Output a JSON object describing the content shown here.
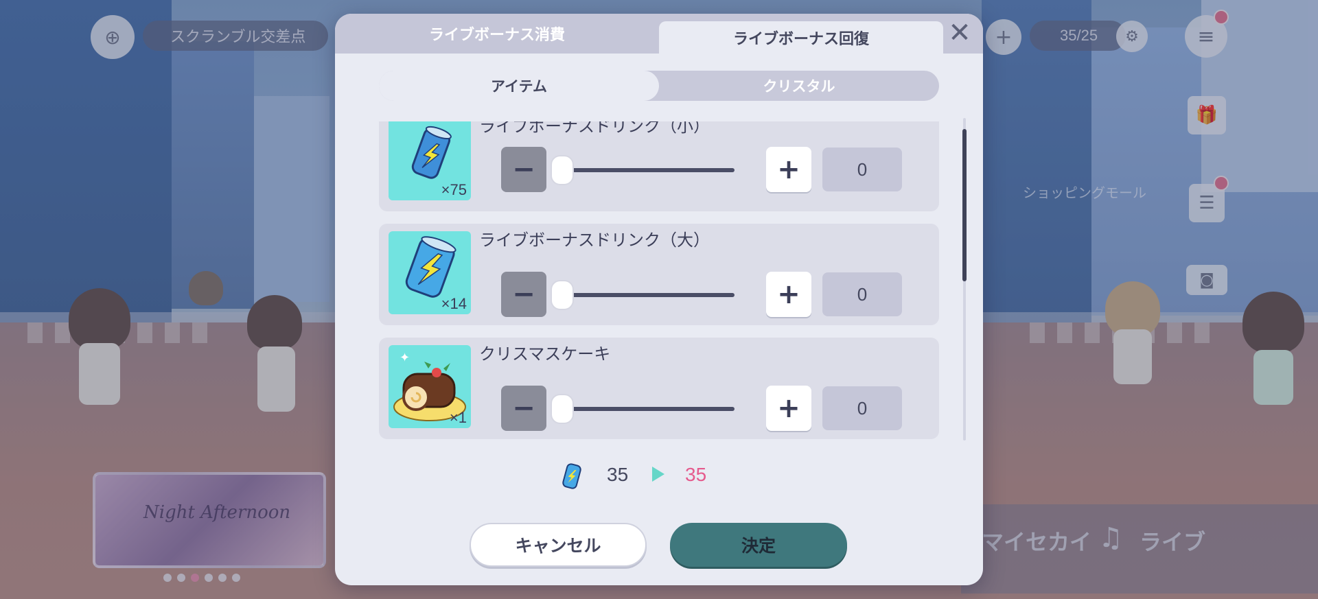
{
  "hud": {
    "location": "スクランブル交差点",
    "energy_current": "35",
    "energy_max": "25",
    "shopping_label": "ショッピングモール"
  },
  "bottom_nav": {
    "my_sekai": "マイセカイ",
    "live": "ライブ"
  },
  "banner": {
    "title": "Night Afternoon"
  },
  "modal": {
    "tabs": [
      {
        "label": "ライブボーナス消費",
        "active": false
      },
      {
        "label": "ライブボーナス回復",
        "active": true
      }
    ],
    "close_icon": "close-icon",
    "segments": [
      {
        "label": "アイテム",
        "active": true
      },
      {
        "label": "クリスタル",
        "active": false
      }
    ],
    "items": [
      {
        "name": "ライブボーナスドリンク（小）",
        "quantity": "×75",
        "value": "0",
        "icon": "small-drink-can-icon"
      },
      {
        "name": "ライブボーナスドリンク（大）",
        "quantity": "×14",
        "value": "0",
        "icon": "large-drink-can-icon"
      },
      {
        "name": "クリスマスケーキ",
        "quantity": "×1",
        "value": "0",
        "icon": "christmas-cake-icon"
      }
    ],
    "stepper": {
      "minus": "−",
      "plus": "+"
    },
    "summary": {
      "from": "35",
      "to": "35"
    },
    "buttons": {
      "cancel": "キャンセル",
      "ok": "決定"
    }
  },
  "colors": {
    "accent": "#3f787d",
    "highlight_value": "#e55a8d",
    "arrow": "#66d6c8",
    "thumb_bg": "#72e3e0"
  }
}
